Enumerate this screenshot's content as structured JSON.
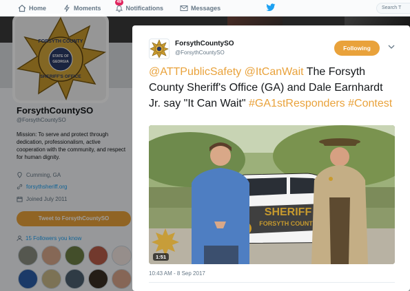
{
  "nav": {
    "home": "Home",
    "moments": "Moments",
    "notifications": "Notifications",
    "notifications_count": "49",
    "messages": "Messages",
    "search_placeholder": "Search T"
  },
  "profile": {
    "name": "ForsythCountySO",
    "handle": "@ForsythCountySO",
    "bio": "Mission: To serve and protect through dedication, professionalism, active cooperation with the community, and respect for human dignity.",
    "location": "Cumming, GA",
    "website": "forsythsheriff.org",
    "joined": "Joined July 2011",
    "tweet_to_label": "Tweet to ForsythCountySO",
    "followers_count_text": "15 Followers you know",
    "avatar_badge_text": {
      "top": "FORSYTH COUNTY",
      "state_top": "STATE OF",
      "state": "GEORGIA",
      "bottom": "SHERIFF'S OFFICE"
    }
  },
  "tweet": {
    "display_name": "ForsythCountySO",
    "handle": "@ForsythCountySO",
    "follow_label": "Following",
    "mention1": "@ATTPublicSafety",
    "mention2": "@ItCanWait",
    "body": "The Forsyth County Sheriff's Office (GA) and Dale Earnhardt Jr. say \"It Can Wait\"",
    "hashtag1": "#GA1stResponders",
    "hashtag2": "#Contest",
    "video_duration": "1:51",
    "video_car_text_1": "SHERIFF",
    "video_car_text_2": "FORSYTH COUNTY",
    "timestamp": "10:43 AM - 8 Sep 2017"
  },
  "colors": {
    "accent": "#e9a23b",
    "link": "#1da1f2",
    "twitter_blue": "#1da1f2"
  }
}
